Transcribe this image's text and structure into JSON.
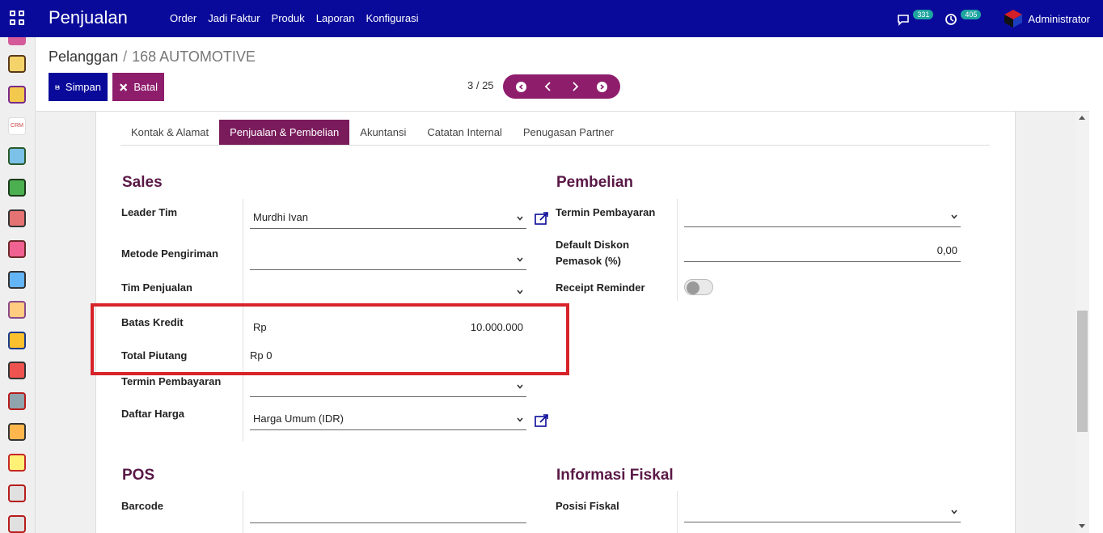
{
  "topbar": {
    "app_title": "Penjualan",
    "menu": [
      "Order",
      "Jadi Faktur",
      "Produk",
      "Laporan",
      "Konfigurasi"
    ],
    "messages_count": "331",
    "activities_count": "405",
    "user_name": "Administrator",
    "accent": "#0a0a9a"
  },
  "sidebar": {
    "apps": [
      "discuss-app-icon",
      "notes-app-icon",
      "contacts-app-icon",
      "crm-app-icon",
      "sales-app-icon",
      "invoicing-app-icon",
      "employees-app-icon",
      "pos-app-icon",
      "purchase-app-icon",
      "inventory-app-icon",
      "barcode-app-icon",
      "manufacturing-app-icon",
      "tools-app-icon",
      "dashboard-app-icon",
      "timesheet-app-icon",
      "calendar-app-icon",
      "planning-app-icon"
    ]
  },
  "control": {
    "breadcrumb_parent": "Pelanggan",
    "breadcrumb_sep": "/",
    "breadcrumb_current": "168 AUTOMOTIVE",
    "save_label": "Simpan",
    "cancel_label": "Batal",
    "pager_text": "3 / 25"
  },
  "tabs": [
    {
      "label": "Kontak & Alamat",
      "active": false
    },
    {
      "label": "Penjualan & Pembelian",
      "active": true
    },
    {
      "label": "Akuntansi",
      "active": false
    },
    {
      "label": "Catatan Internal",
      "active": false
    },
    {
      "label": "Penugasan Partner",
      "active": false
    }
  ],
  "sales": {
    "title": "Sales",
    "leader_tim_label": "Leader Tim",
    "leader_tim_value": "Murdhi Ivan",
    "metode_pengiriman_label": "Metode Pengiriman",
    "metode_pengiriman_value": "",
    "tim_penjualan_label": "Tim Penjualan",
    "tim_penjualan_value": "",
    "batas_kredit_label": "Batas Kredit",
    "batas_kredit_currency": "Rp",
    "batas_kredit_value": "10.000.000",
    "total_piutang_label": "Total Piutang",
    "total_piutang_value": "Rp 0",
    "termin_pembayaran_label": "Termin Pembayaran",
    "termin_pembayaran_value": "",
    "daftar_harga_label": "Daftar Harga",
    "daftar_harga_value": "Harga Umum (IDR)"
  },
  "pembelian": {
    "title": "Pembelian",
    "termin_pembayaran_label": "Termin Pembayaran",
    "termin_pembayaran_value": "",
    "default_diskon_label_1": "Default Diskon",
    "default_diskon_label_2": "Pemasok (%)",
    "default_diskon_value": "0,00",
    "receipt_reminder_label": "Receipt Reminder",
    "receipt_reminder_on": false
  },
  "pos": {
    "title": "POS",
    "barcode_label": "Barcode",
    "barcode_value": ""
  },
  "fiskal": {
    "title": "Informasi Fiskal",
    "posisi_fiskal_label": "Posisi Fiskal",
    "posisi_fiskal_value": ""
  },
  "colors": {
    "brand": "#0a0a9a",
    "secondary": "#8e1d6c",
    "section_title": "#5a1846",
    "highlight_box": "#d8232a"
  }
}
